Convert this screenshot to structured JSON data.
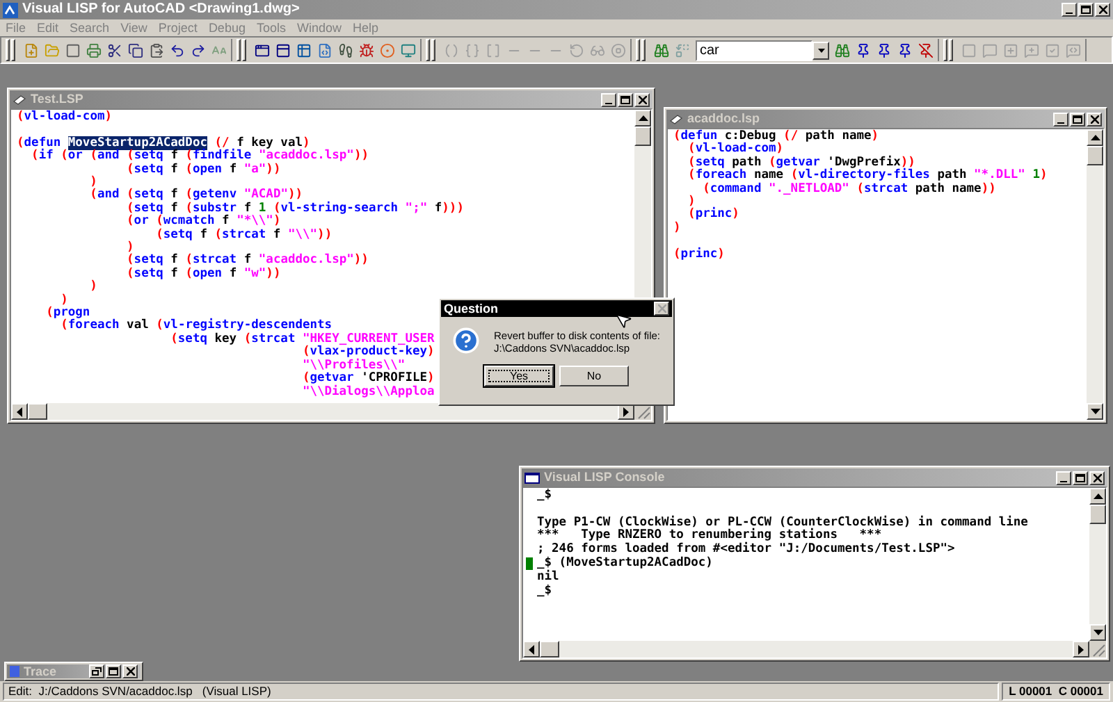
{
  "main_window": {
    "title": "Visual LISP for AutoCAD <Drawing1.dwg>"
  },
  "menu": [
    "File",
    "Edit",
    "Search",
    "View",
    "Project",
    "Debug",
    "Tools",
    "Window",
    "Help"
  ],
  "toolbars": [
    {
      "disabled": false
    },
    {
      "disabled": false
    },
    {
      "disabled": true
    },
    {
      "disabled": false,
      "search_value": "car"
    },
    {
      "disabled": true
    }
  ],
  "editors": [
    {
      "title": "Test.LSP",
      "active": false,
      "lines": [
        {
          "kind": "code",
          "tokens": [
            {
              "kind": "paren",
              "text": "("
            },
            {
              "kind": "function",
              "text": "vl-load-com"
            },
            {
              "kind": "paren",
              "text": ")"
            }
          ]
        },
        {
          "kind": "blank"
        },
        {
          "kind": "code",
          "tokens": [
            {
              "kind": "paren",
              "text": "("
            },
            {
              "kind": "function",
              "text": "defun "
            },
            {
              "kind": "selected",
              "text": "MoveStartup2ACadDoc"
            },
            {
              "kind": "paren",
              "text": " (/"
            },
            {
              "kind": "symbol",
              "text": " f key val"
            },
            {
              "kind": "paren",
              "text": ")"
            }
          ]
        },
        {
          "kind": "code",
          "tokens": [
            {
              "kind": "paren",
              "text": "  ("
            },
            {
              "kind": "function",
              "text": "if "
            },
            {
              "kind": "paren",
              "text": "("
            },
            {
              "kind": "function",
              "text": "or "
            },
            {
              "kind": "paren",
              "text": "("
            },
            {
              "kind": "function",
              "text": "and "
            },
            {
              "kind": "paren",
              "text": "("
            },
            {
              "kind": "function",
              "text": "setq "
            },
            {
              "kind": "symbol",
              "text": "f "
            },
            {
              "kind": "paren",
              "text": "("
            },
            {
              "kind": "function",
              "text": "findfile "
            },
            {
              "kind": "string",
              "text": "\"acaddoc.lsp\""
            },
            {
              "kind": "paren",
              "text": "))"
            }
          ]
        },
        {
          "kind": "code",
          "tokens": [
            {
              "kind": "paren",
              "text": "               ("
            },
            {
              "kind": "function",
              "text": "setq "
            },
            {
              "kind": "symbol",
              "text": "f "
            },
            {
              "kind": "paren",
              "text": "("
            },
            {
              "kind": "function",
              "text": "open "
            },
            {
              "kind": "symbol",
              "text": "f "
            },
            {
              "kind": "string",
              "text": "\"a\""
            },
            {
              "kind": "paren",
              "text": "))"
            }
          ]
        },
        {
          "kind": "code",
          "tokens": [
            {
              "kind": "paren",
              "text": "          )"
            }
          ]
        },
        {
          "kind": "code",
          "tokens": [
            {
              "kind": "paren",
              "text": "          ("
            },
            {
              "kind": "function",
              "text": "and "
            },
            {
              "kind": "paren",
              "text": "("
            },
            {
              "kind": "function",
              "text": "setq "
            },
            {
              "kind": "symbol",
              "text": "f "
            },
            {
              "kind": "paren",
              "text": "("
            },
            {
              "kind": "function",
              "text": "getenv "
            },
            {
              "kind": "string",
              "text": "\"ACAD\""
            },
            {
              "kind": "paren",
              "text": "))"
            }
          ]
        },
        {
          "kind": "code",
          "tokens": [
            {
              "kind": "paren",
              "text": "               ("
            },
            {
              "kind": "function",
              "text": "setq "
            },
            {
              "kind": "symbol",
              "text": "f "
            },
            {
              "kind": "paren",
              "text": "("
            },
            {
              "kind": "function",
              "text": "substr "
            },
            {
              "kind": "symbol",
              "text": "f "
            },
            {
              "kind": "number",
              "text": "1 "
            },
            {
              "kind": "paren",
              "text": "("
            },
            {
              "kind": "function",
              "text": "vl-string-search "
            },
            {
              "kind": "string",
              "text": "\";\""
            },
            {
              "kind": "symbol",
              "text": " f"
            },
            {
              "kind": "paren",
              "text": ")))"
            }
          ]
        },
        {
          "kind": "code",
          "tokens": [
            {
              "kind": "paren",
              "text": "               ("
            },
            {
              "kind": "function",
              "text": "or "
            },
            {
              "kind": "paren",
              "text": "("
            },
            {
              "kind": "function",
              "text": "wcmatch "
            },
            {
              "kind": "symbol",
              "text": "f "
            },
            {
              "kind": "string",
              "text": "\"*\\\\\""
            },
            {
              "kind": "paren",
              "text": ")"
            }
          ]
        },
        {
          "kind": "code",
          "tokens": [
            {
              "kind": "paren",
              "text": "                   ("
            },
            {
              "kind": "function",
              "text": "setq "
            },
            {
              "kind": "symbol",
              "text": "f "
            },
            {
              "kind": "paren",
              "text": "("
            },
            {
              "kind": "function",
              "text": "strcat "
            },
            {
              "kind": "symbol",
              "text": "f "
            },
            {
              "kind": "string",
              "text": "\"\\\\\""
            },
            {
              "kind": "paren",
              "text": "))"
            }
          ]
        },
        {
          "kind": "code",
          "tokens": [
            {
              "kind": "paren",
              "text": "               )"
            }
          ]
        },
        {
          "kind": "code",
          "tokens": [
            {
              "kind": "paren",
              "text": "               ("
            },
            {
              "kind": "function",
              "text": "setq "
            },
            {
              "kind": "symbol",
              "text": "f "
            },
            {
              "kind": "paren",
              "text": "("
            },
            {
              "kind": "function",
              "text": "strcat "
            },
            {
              "kind": "symbol",
              "text": "f "
            },
            {
              "kind": "string",
              "text": "\"acaddoc.lsp\""
            },
            {
              "kind": "paren",
              "text": "))"
            }
          ]
        },
        {
          "kind": "code",
          "tokens": [
            {
              "kind": "paren",
              "text": "               ("
            },
            {
              "kind": "function",
              "text": "setq "
            },
            {
              "kind": "symbol",
              "text": "f "
            },
            {
              "kind": "paren",
              "text": "("
            },
            {
              "kind": "function",
              "text": "open "
            },
            {
              "kind": "symbol",
              "text": "f "
            },
            {
              "kind": "string",
              "text": "\"w\""
            },
            {
              "kind": "paren",
              "text": "))"
            }
          ]
        },
        {
          "kind": "code",
          "tokens": [
            {
              "kind": "paren",
              "text": "          )"
            }
          ]
        },
        {
          "kind": "code",
          "tokens": [
            {
              "kind": "paren",
              "text": "      )"
            }
          ]
        },
        {
          "kind": "code",
          "tokens": [
            {
              "kind": "paren",
              "text": "    ("
            },
            {
              "kind": "function",
              "text": "progn"
            }
          ]
        },
        {
          "kind": "code",
          "tokens": [
            {
              "kind": "paren",
              "text": "      ("
            },
            {
              "kind": "function",
              "text": "foreach "
            },
            {
              "kind": "symbol",
              "text": "val "
            },
            {
              "kind": "paren",
              "text": "("
            },
            {
              "kind": "function",
              "text": "vl-registry-descendents"
            }
          ]
        },
        {
          "kind": "code",
          "tokens": [
            {
              "kind": "paren",
              "text": "                     ("
            },
            {
              "kind": "function",
              "text": "setq "
            },
            {
              "kind": "symbol",
              "text": "key "
            },
            {
              "kind": "paren",
              "text": "("
            },
            {
              "kind": "function",
              "text": "strcat "
            },
            {
              "kind": "string",
              "text": "\"HKEY_CURRENT_USER"
            }
          ]
        },
        {
          "kind": "code",
          "tokens": [
            {
              "kind": "paren",
              "text": "                                       ("
            },
            {
              "kind": "function",
              "text": "vlax-product-key"
            },
            {
              "kind": "paren",
              "text": ")"
            }
          ]
        },
        {
          "kind": "code",
          "tokens": [
            {
              "kind": "string",
              "text": "                                       \"\\\\Profiles\\\\\""
            }
          ]
        },
        {
          "kind": "code",
          "tokens": [
            {
              "kind": "paren",
              "text": "                                       ("
            },
            {
              "kind": "function",
              "text": "getvar "
            },
            {
              "kind": "symbol",
              "text": "'CPROFILE"
            },
            {
              "kind": "paren",
              "text": ")"
            }
          ]
        },
        {
          "kind": "code",
          "tokens": [
            {
              "kind": "string",
              "text": "                                       \"\\\\Dialogs\\\\Apploa"
            }
          ]
        }
      ]
    },
    {
      "title": "acaddoc.lsp",
      "active": false,
      "lines": [
        {
          "kind": "code",
          "tokens": [
            {
              "kind": "paren",
              "text": "("
            },
            {
              "kind": "function",
              "text": "defun "
            },
            {
              "kind": "symbol",
              "text": "c:Debug "
            },
            {
              "kind": "paren",
              "text": "(/"
            },
            {
              "kind": "symbol",
              "text": " path name"
            },
            {
              "kind": "paren",
              "text": ")"
            }
          ]
        },
        {
          "kind": "code",
          "tokens": [
            {
              "kind": "paren",
              "text": "  ("
            },
            {
              "kind": "function",
              "text": "vl-load-com"
            },
            {
              "kind": "paren",
              "text": ")"
            }
          ]
        },
        {
          "kind": "code",
          "tokens": [
            {
              "kind": "paren",
              "text": "  ("
            },
            {
              "kind": "function",
              "text": "setq "
            },
            {
              "kind": "symbol",
              "text": "path "
            },
            {
              "kind": "paren",
              "text": "("
            },
            {
              "kind": "function",
              "text": "getvar "
            },
            {
              "kind": "symbol",
              "text": "'DwgPrefix"
            },
            {
              "kind": "paren",
              "text": "))"
            }
          ]
        },
        {
          "kind": "code",
          "tokens": [
            {
              "kind": "paren",
              "text": "  ("
            },
            {
              "kind": "function",
              "text": "foreach "
            },
            {
              "kind": "symbol",
              "text": "name "
            },
            {
              "kind": "paren",
              "text": "("
            },
            {
              "kind": "function",
              "text": "vl-directory-files "
            },
            {
              "kind": "symbol",
              "text": "path "
            },
            {
              "kind": "string",
              "text": "\"*.DLL\""
            },
            {
              "kind": "number",
              "text": " 1"
            },
            {
              "kind": "paren",
              "text": ")"
            }
          ]
        },
        {
          "kind": "code",
          "tokens": [
            {
              "kind": "paren",
              "text": "    ("
            },
            {
              "kind": "function",
              "text": "command "
            },
            {
              "kind": "string",
              "text": "\"._NETLOAD\""
            },
            {
              "kind": "paren",
              "text": " ("
            },
            {
              "kind": "function",
              "text": "strcat "
            },
            {
              "kind": "symbol",
              "text": "path name"
            },
            {
              "kind": "paren",
              "text": "))"
            }
          ]
        },
        {
          "kind": "code",
          "tokens": [
            {
              "kind": "paren",
              "text": "  )"
            }
          ]
        },
        {
          "kind": "code",
          "tokens": [
            {
              "kind": "paren",
              "text": "  ("
            },
            {
              "kind": "function",
              "text": "princ"
            },
            {
              "kind": "paren",
              "text": ")"
            }
          ]
        },
        {
          "kind": "code",
          "tokens": [
            {
              "kind": "paren",
              "text": ")"
            }
          ]
        },
        {
          "kind": "blank"
        },
        {
          "kind": "code",
          "tokens": [
            {
              "kind": "paren",
              "text": "("
            },
            {
              "kind": "function",
              "text": "princ"
            },
            {
              "kind": "paren",
              "text": ")"
            }
          ]
        }
      ]
    }
  ],
  "dialog": {
    "title": "Question",
    "active": true,
    "message": [
      "Revert buffer to disk contents of file:",
      "J:\\Caddons SVN\\acaddoc.lsp"
    ],
    "buttons": [
      {
        "label": "Yes",
        "default": true
      },
      {
        "label": "No",
        "default": false
      }
    ]
  },
  "console": {
    "title": "Visual LISP Console",
    "active": false,
    "lines": [
      {
        "kind": "text",
        "text": "_$",
        "cursor": false
      },
      {
        "kind": "blank",
        "cursor": false
      },
      {
        "kind": "text",
        "text": "Type P1-CW (ClockWise) or PL-CCW (CounterClockWise) in command line",
        "cursor": false
      },
      {
        "kind": "text",
        "text": "***   Type RNZERO to renumbering stations   ***",
        "cursor": false
      },
      {
        "kind": "text",
        "text": "; 246 forms loaded from #<editor \"J:/Documents/Test.LSP\">",
        "cursor": false
      },
      {
        "kind": "text",
        "text": "_$ (MoveStartup2ACadDoc)",
        "cursor": true
      },
      {
        "kind": "text",
        "text": "nil",
        "cursor": false
      },
      {
        "kind": "text",
        "text": "_$",
        "cursor": false
      }
    ]
  },
  "trace": {
    "title": "Trace"
  },
  "status_bar": {
    "text": "Edit:  J:/Caddons SVN/acaddoc.lsp   (Visual LISP)",
    "position": "L 00001  C 00001"
  }
}
